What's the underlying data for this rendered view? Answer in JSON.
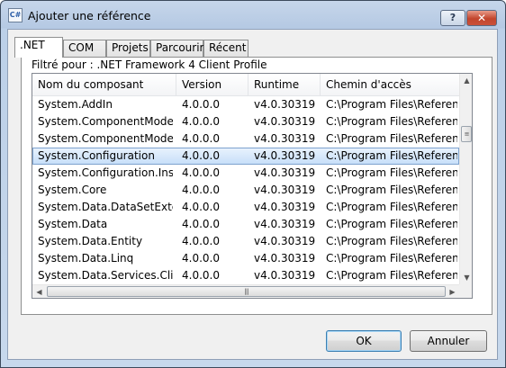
{
  "window": {
    "title": "Ajouter une référence",
    "app_icon_text": "C#",
    "help_label": "?",
    "close_label": "✕"
  },
  "tabs": [
    {
      "label": ".NET",
      "active": true
    },
    {
      "label": "COM",
      "active": false
    },
    {
      "label": "Projets",
      "active": false
    },
    {
      "label": "Parcourir",
      "active": false
    },
    {
      "label": "Récent",
      "active": false
    }
  ],
  "filter_text": "Filtré pour : .NET Framework 4 Client Profile",
  "table": {
    "columns": [
      "Nom du composant",
      "Version",
      "Runtime",
      "Chemin d'accès"
    ],
    "selected_index": 3,
    "rows": [
      [
        "System.AddIn",
        "4.0.0.0",
        "v4.0.30319",
        "C:\\Program Files\\Referen"
      ],
      [
        "System.ComponentModel...",
        "4.0.0.0",
        "v4.0.30319",
        "C:\\Program Files\\Referen"
      ],
      [
        "System.ComponentModel...",
        "4.0.0.0",
        "v4.0.30319",
        "C:\\Program Files\\Referen"
      ],
      [
        "System.Configuration",
        "4.0.0.0",
        "v4.0.30319",
        "C:\\Program Files\\Referen"
      ],
      [
        "System.Configuration.Install",
        "4.0.0.0",
        "v4.0.30319",
        "C:\\Program Files\\Referen"
      ],
      [
        "System.Core",
        "4.0.0.0",
        "v4.0.30319",
        "C:\\Program Files\\Referen"
      ],
      [
        "System.Data.DataSetExtens...",
        "4.0.0.0",
        "v4.0.30319",
        "C:\\Program Files\\Referen"
      ],
      [
        "System.Data",
        "4.0.0.0",
        "v4.0.30319",
        "C:\\Program Files\\Referen"
      ],
      [
        "System.Data.Entity",
        "4.0.0.0",
        "v4.0.30319",
        "C:\\Program Files\\Referen"
      ],
      [
        "System.Data.Linq",
        "4.0.0.0",
        "v4.0.30319",
        "C:\\Program Files\\Referen"
      ],
      [
        "System.Data.Services.Client",
        "4.0.0.0",
        "v4.0.30319",
        "C:\\Program Files\\Referen"
      ]
    ]
  },
  "buttons": {
    "ok": "OK",
    "cancel": "Annuler"
  }
}
